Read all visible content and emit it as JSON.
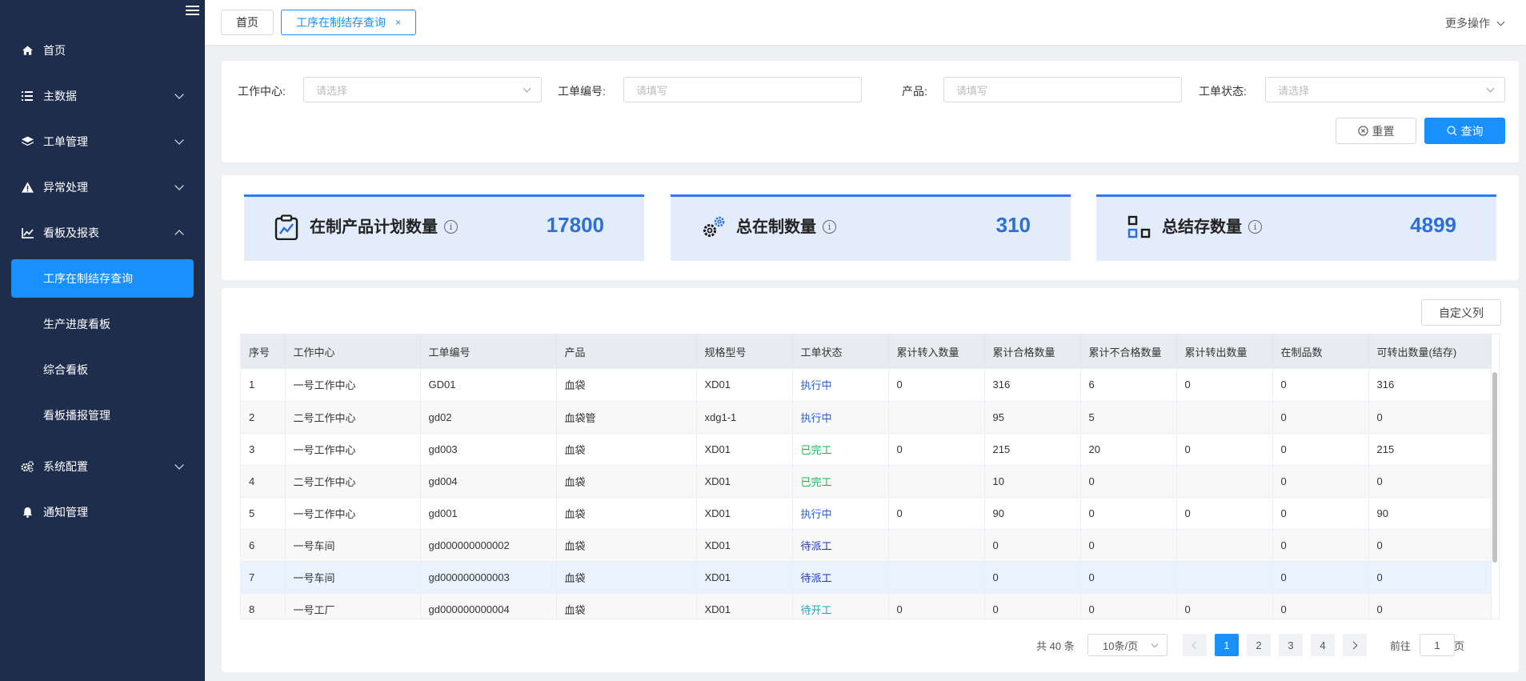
{
  "sidebar": {
    "items": [
      {
        "label": "首页",
        "icon": "home-icon"
      },
      {
        "label": "主数据",
        "icon": "list-icon"
      },
      {
        "label": "工单管理",
        "icon": "layers-icon"
      },
      {
        "label": "异常处理",
        "icon": "warning-icon"
      },
      {
        "label": "看板及报表",
        "icon": "chart-icon"
      },
      {
        "label": "系统配置",
        "icon": "gears-icon"
      },
      {
        "label": "通知管理",
        "icon": "bell-icon"
      }
    ],
    "sub_items": [
      {
        "label": "工序在制结存查询",
        "active": true
      },
      {
        "label": "生产进度看板"
      },
      {
        "label": "综合看板"
      },
      {
        "label": "看板播报管理"
      }
    ]
  },
  "topbar": {
    "tabs": [
      {
        "label": "首页"
      },
      {
        "label": "工序在制结存查询",
        "close": "×"
      }
    ],
    "more_ops": "更多操作"
  },
  "filters": {
    "work_center_label": "工作中心:",
    "work_center_placeholder": "请选择",
    "order_no_label": "工单编号:",
    "order_no_placeholder": "请填写",
    "product_label": "产品:",
    "product_placeholder": "请填写",
    "order_status_label": "工单状态:",
    "order_status_placeholder": "请选择",
    "reset_label": "重置",
    "query_label": "查询"
  },
  "stats": [
    {
      "label": "在制产品计划数量",
      "value": "17800",
      "icon": "clipboard-chart-icon"
    },
    {
      "label": "总在制数量",
      "value": "310",
      "icon": "gears-icon"
    },
    {
      "label": "总结存数量",
      "value": "4899",
      "icon": "blocks-icon"
    }
  ],
  "stats_info_symbol": "i",
  "table": {
    "custom_columns_label": "自定义列",
    "columns": [
      "序号",
      "工作中心",
      "工单编号",
      "产品",
      "规格型号",
      "工单状态",
      "累计转入数量",
      "累计合格数量",
      "累计不合格数量",
      "累计转出数量",
      "在制品数",
      "可转出数量(结存)"
    ],
    "rows": [
      [
        "1",
        "一号工作中心",
        "GD01",
        "血袋",
        "XD01",
        "执行中",
        "0",
        "316",
        "6",
        "0",
        "0",
        "316"
      ],
      [
        "2",
        "二号工作中心",
        "gd02",
        "血袋管",
        "xdg1-1",
        "执行中",
        "",
        "95",
        "5",
        "",
        "0",
        "0"
      ],
      [
        "3",
        "一号工作中心",
        "gd003",
        "血袋",
        "XD01",
        "已完工",
        "0",
        "215",
        "20",
        "0",
        "0",
        "215"
      ],
      [
        "4",
        "二号工作中心",
        "gd004",
        "血袋",
        "XD01",
        "已完工",
        "",
        "10",
        "0",
        "",
        "0",
        "0"
      ],
      [
        "5",
        "一号工作中心",
        "gd001",
        "血袋",
        "XD01",
        "执行中",
        "0",
        "90",
        "0",
        "0",
        "0",
        "90"
      ],
      [
        "6",
        "一号车间",
        "gd000000000002",
        "血袋",
        "XD01",
        "待派工",
        "",
        "0",
        "0",
        "",
        "0",
        "0"
      ],
      [
        "7",
        "一号车间",
        "gd000000000003",
        "血袋",
        "XD01",
        "待派工",
        "",
        "0",
        "0",
        "",
        "0",
        "0"
      ],
      [
        "8",
        "一号工厂",
        "gd000000000004",
        "血袋",
        "XD01",
        "待开工",
        "0",
        "0",
        "0",
        "0",
        "0",
        "0"
      ]
    ],
    "status_colors": {
      "执行中": "#1d5fe3",
      "已完工": "#19b54f",
      "待派工": "#2332c2",
      "待开工": "#1ea5b8"
    }
  },
  "pagination": {
    "total": "共 40 条",
    "page_size": "10条/页",
    "pages": [
      "1",
      "2",
      "3",
      "4"
    ],
    "current_page": "1",
    "goto_prefix": "前往",
    "goto_value": "1",
    "goto_suffix": "页"
  },
  "colors": {
    "sidebar_bg": "#1f2d4d",
    "accent": "#1890ff",
    "stat_value": "#2d6fd6"
  }
}
